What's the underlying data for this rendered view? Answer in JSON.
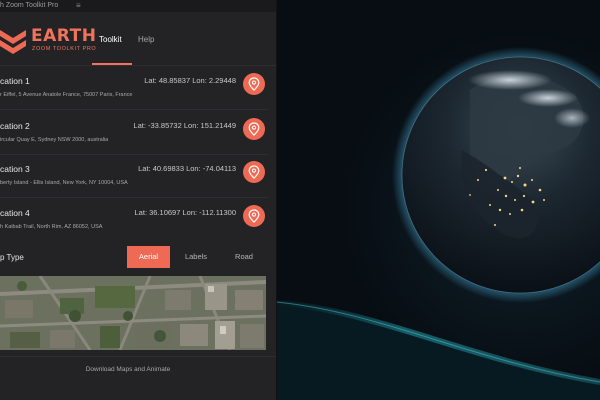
{
  "window": {
    "title": "h Zoom Toolkit Pro",
    "menu_glyph": "≡"
  },
  "brand": {
    "name": "EARTH",
    "subtitle": "ZOOM TOOLKIT PRO",
    "accent": "#ef6a55"
  },
  "tabs": [
    {
      "label": "Toolkit",
      "active": true
    },
    {
      "label": "Help",
      "active": false
    }
  ],
  "locations": [
    {
      "name": "cation 1",
      "coords": "Lat: 48.85837  Lon: 2.29448",
      "address": "r Eiffel, 5 Avenue Anatole France, 75007 Paris, France",
      "icon": "map-pin-icon"
    },
    {
      "name": "cation 2",
      "coords": "Lat: -33.85732  Lon: 151.21449",
      "address": "ircular Quay E, Sydney NSW 2000, australia",
      "icon": "map-pin-icon"
    },
    {
      "name": "cation 3",
      "coords": "Lat: 40.69833  Lon: -74.04113",
      "address": "berty Island - Ellis Island, New York, NY 10004, USA",
      "icon": "map-pin-icon"
    },
    {
      "name": "cation 4",
      "coords": "Lat: 36.10697  Lon: -112.11300",
      "address": "h Kaibab Trail, North Rim, AZ 86052, USA",
      "icon": "map-pin-icon"
    }
  ],
  "map_type": {
    "label": "p Type",
    "options": [
      "Aerial",
      "Labels",
      "Road"
    ],
    "selected": "Aerial"
  },
  "download_label": "Download Maps and Animate"
}
